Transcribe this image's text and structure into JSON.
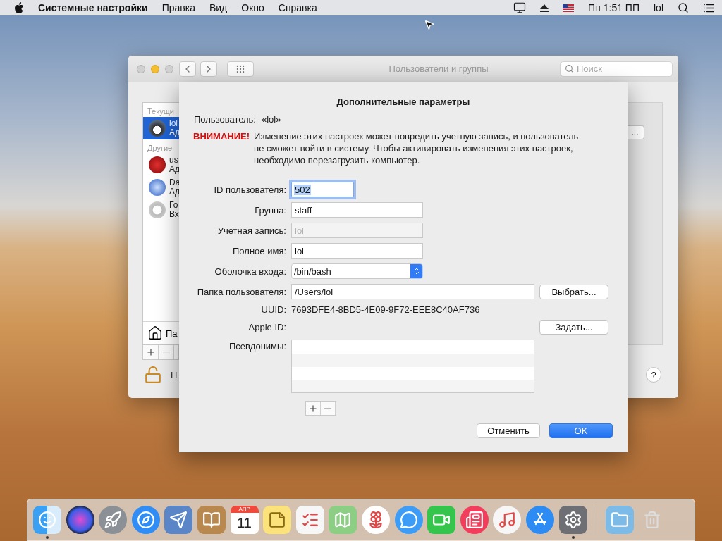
{
  "menu_bar": {
    "app": "Системные настройки",
    "menus": [
      "Правка",
      "Вид",
      "Окно",
      "Справка"
    ],
    "clock": "Пн 1:51 ПП",
    "user": "lol"
  },
  "window": {
    "title": "Пользователи и группы",
    "search": {
      "placeholder": "Поиск"
    },
    "sidebar": {
      "sections": [
        {
          "heading": "Текущи",
          "items": [
            {
              "name": "lol",
              "role": "Ад",
              "kind": "penguin",
              "selected": true
            }
          ]
        },
        {
          "heading": "Другие",
          "items": [
            {
              "name": "us",
              "role": "Ад",
              "kind": "red",
              "selected": false
            },
            {
              "name": "Da",
              "role": "Ад",
              "kind": "blue",
              "selected": false
            },
            {
              "name": "Го",
              "role": "Вх",
              "kind": "guest",
              "selected": false
            }
          ]
        }
      ],
      "login_options": "Па"
    },
    "lock_label": "Н",
    "side_button": "...",
    "help": "?"
  },
  "sheet": {
    "title": "Дополнительные параметры",
    "user_label": "Пользователь:",
    "user_value": "«lol»",
    "warning_label": "ВНИМАНИЕ!",
    "warning_text": "Изменение этих настроек может повредить учетную запись, и пользователь не сможет войти в систему. Чтобы активировать изменения этих настроек, необходимо перезагрузить компьютер.",
    "fields": [
      {
        "label": "ID пользователя:",
        "kind": "text",
        "value": "502",
        "focused": true,
        "disabled": false
      },
      {
        "label": "Группа:",
        "kind": "text",
        "value": "staff",
        "focused": false,
        "disabled": false
      },
      {
        "label": "Учетная запись:",
        "kind": "text",
        "value": "lol",
        "focused": false,
        "disabled": true
      },
      {
        "label": "Полное имя:",
        "kind": "text",
        "value": "lol",
        "focused": false,
        "disabled": false
      },
      {
        "label": "Оболочка входа:",
        "kind": "popup",
        "value": "/bin/bash"
      },
      {
        "label": "Папка пользователя:",
        "kind": "wide",
        "value": "/Users/lol",
        "focused": false,
        "disabled": false,
        "button": "Выбрать..."
      },
      {
        "label": "UUID:",
        "kind": "static",
        "value": "7693DFE4-8BD5-4E09-9F72-EEE8C40AF736"
      },
      {
        "label": "Apple ID:",
        "kind": "static",
        "button": "Задать..."
      },
      {
        "label": "Псевдонимы:",
        "kind": "list"
      }
    ],
    "cancel": "Отменить",
    "ok": "OK"
  },
  "dock": {
    "items": [
      {
        "kind": "finder",
        "running": true
      },
      {
        "kind": "siri",
        "running": false
      },
      {
        "kind": "launchpad",
        "running": false
      },
      {
        "kind": "safari",
        "running": false
      },
      {
        "kind": "mail",
        "running": false
      },
      {
        "kind": "contacts",
        "running": false
      },
      {
        "kind": "calendar",
        "running": false,
        "month": "АПР",
        "day": "11"
      },
      {
        "kind": "notes",
        "running": false
      },
      {
        "kind": "reminders",
        "running": false
      },
      {
        "kind": "maps",
        "running": false
      },
      {
        "kind": "photos",
        "running": false
      },
      {
        "kind": "messages",
        "running": false
      },
      {
        "kind": "facetime",
        "running": false
      },
      {
        "kind": "news",
        "running": false
      },
      {
        "kind": "music",
        "running": false
      },
      {
        "kind": "appstore",
        "running": false
      },
      {
        "kind": "settings",
        "running": true
      },
      {
        "kind": "divider"
      },
      {
        "kind": "downloads",
        "running": false
      },
      {
        "kind": "trash",
        "running": false
      }
    ]
  }
}
